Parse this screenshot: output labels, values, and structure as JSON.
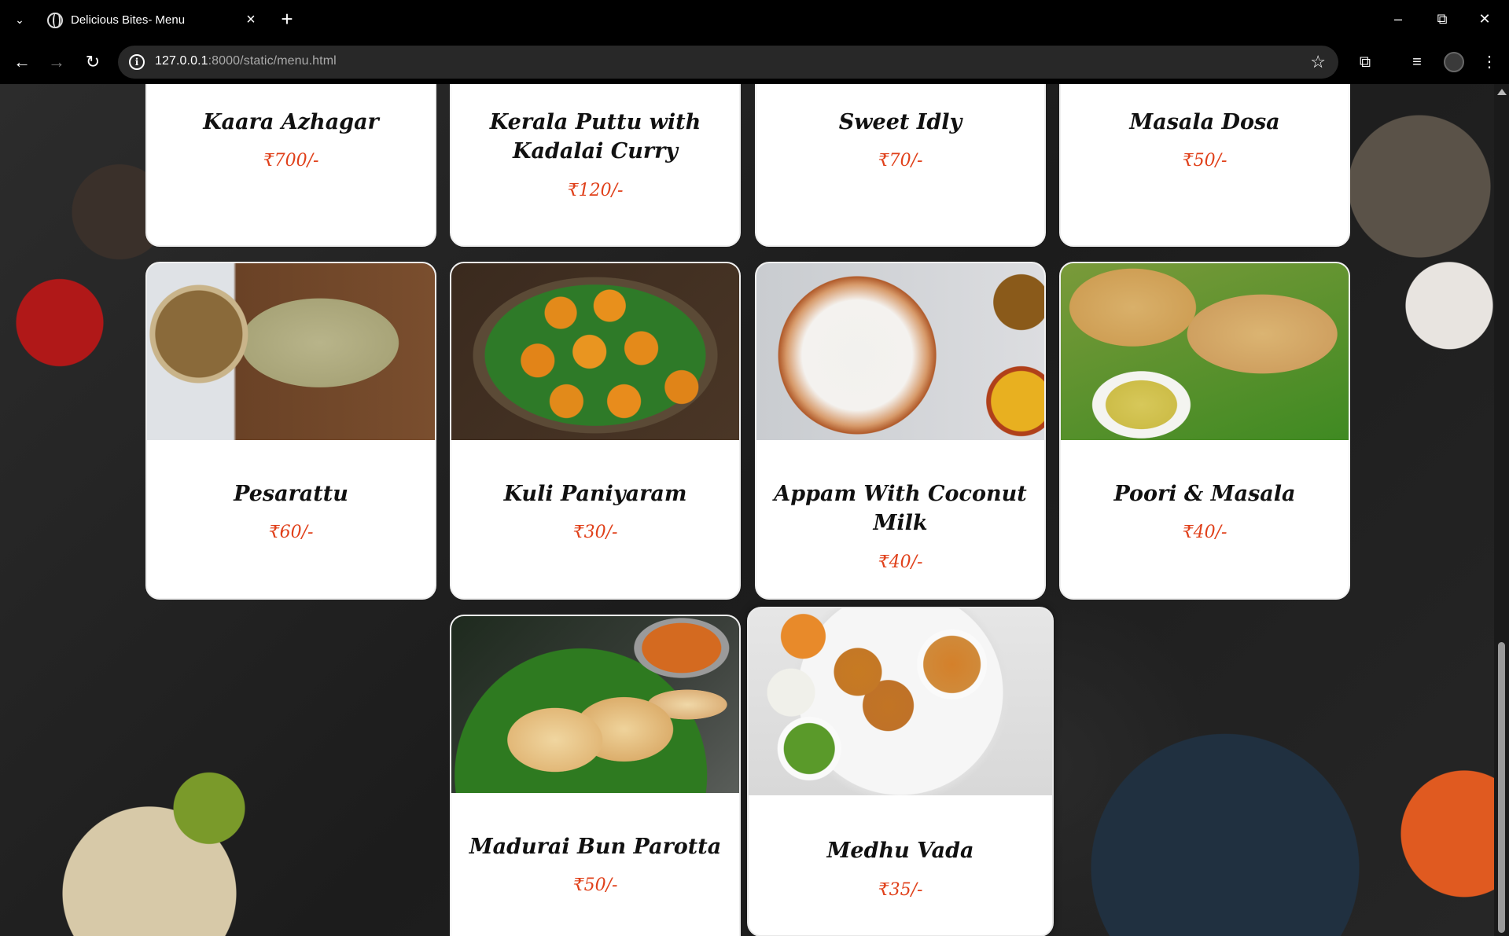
{
  "browser": {
    "tab_title": "Delicious Bites- Menu",
    "url_host": "127.0.0.1",
    "url_rest": ":8000/static/menu.html",
    "icons": {
      "tab_list": "chevron-down-icon",
      "globe": "globe-icon",
      "close": "close-icon",
      "new_tab": "plus-icon",
      "back": "arrow-left-icon",
      "forward": "arrow-right-icon",
      "reload": "reload-icon",
      "site_info": "info-icon",
      "bookmark": "star-icon",
      "extensions": "puzzle-icon",
      "media": "media-queue-icon",
      "menu": "kebab-menu-icon"
    }
  },
  "menu": {
    "items": [
      {
        "name": "Kaara Azhagar",
        "price": "₹700/-"
      },
      {
        "name": "Kerala Puttu with Kadalai Curry",
        "price": "₹120/-"
      },
      {
        "name": "Sweet Idly",
        "price": "₹70/-"
      },
      {
        "name": "Masala Dosa",
        "price": "₹50/-"
      },
      {
        "name": "Pesarattu",
        "price": "₹60/-"
      },
      {
        "name": "Kuli Paniyaram",
        "price": "₹30/-"
      },
      {
        "name": "Appam With Coconut Milk",
        "price": "₹40/-"
      },
      {
        "name": "Poori & Masala",
        "price": "₹40/-"
      },
      {
        "name": "Madurai Bun Parotta",
        "price": "₹50/-"
      },
      {
        "name": "Medhu Vada",
        "price": "₹35/-"
      }
    ]
  },
  "colors": {
    "price": "#e0401a",
    "card": "#ffffff",
    "chrome": "#000000"
  }
}
